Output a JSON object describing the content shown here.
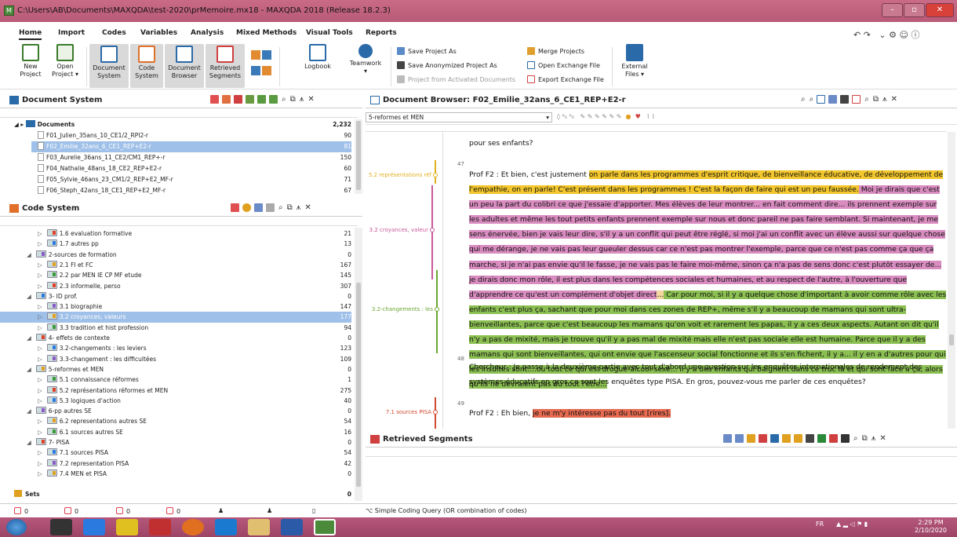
{
  "window": {
    "title": "C:\\Users\\AB\\Documents\\MAXQDA\\test-2020\\prMemoire.mx18 - MAXQDA 2018 (Release 18.2.3)",
    "app_icon": "M"
  },
  "ribbon_tabs": [
    "Home",
    "Import",
    "Codes",
    "Variables",
    "Analysis",
    "Mixed Methods",
    "Visual Tools",
    "Reports"
  ],
  "ribbon": {
    "new_project": "New\nProject",
    "open_project": "Open\nProject ▾",
    "document_system": "Document\nSystem",
    "code_system": "Code\nSystem",
    "document_browser": "Document\nBrowser",
    "retrieved_segments": "Retrieved\nSegments",
    "logbook": "Logbook",
    "teamwork": "Teamwork\n▾",
    "save_project_as": "Save Project As",
    "save_anonymized": "Save Anonymized Project As",
    "project_from_activated": "Project from Activated Documents",
    "merge_projects": "Merge Projects",
    "open_exchange": "Open Exchange File",
    "export_exchange": "Export Exchange File",
    "external_files": "External\nFiles ▾"
  },
  "document_system": {
    "title": "Document System",
    "root": {
      "label": "Documents",
      "count": "2,232"
    },
    "items": [
      {
        "label": "F01_Julien_35ans_10_CE1/2_RPI2-r",
        "count": "90"
      },
      {
        "label": "F02_Emilie_32ans_6_CE1_REP+E2-r",
        "count": "81"
      },
      {
        "label": "F03_Aurelie_36ans_11_CE2/CM1_REP+-r",
        "count": "150"
      },
      {
        "label": "F04_Nathalie_48ans_18_CE2_REP+E2-r",
        "count": "60"
      },
      {
        "label": "F05_Sylvie_46ans_23_CM1/2_REP+E2_MF-r",
        "count": "71"
      },
      {
        "label": "F06_Steph_42ans_18_CE1_REP+E2_MF-r",
        "count": "67"
      }
    ]
  },
  "code_system": {
    "title": "Code System",
    "items": [
      {
        "label": "1.6 evaluation formative",
        "count": "21",
        "level": 2
      },
      {
        "label": "1.7 autres pp",
        "count": "13",
        "level": 2
      },
      {
        "label": "2-sources de formation",
        "count": "0",
        "level": 1
      },
      {
        "label": "2.1 FI et FC",
        "count": "167",
        "level": 2
      },
      {
        "label": "2.2 par MEN IE CP MF etude",
        "count": "145",
        "level": 2
      },
      {
        "label": "2.3 informelle, perso",
        "count": "307",
        "level": 2
      },
      {
        "label": "3- ID prof.",
        "count": "0",
        "level": 1
      },
      {
        "label": "3.1 biographie",
        "count": "147",
        "level": 2
      },
      {
        "label": "3.2 croyances, valeurs",
        "count": "177",
        "level": 2
      },
      {
        "label": "3.3 tradition et hist profession",
        "count": "94",
        "level": 2
      },
      {
        "label": "4- effets de contexte",
        "count": "0",
        "level": 1
      },
      {
        "label": "3.2-changements : les leviers",
        "count": "123",
        "level": 2
      },
      {
        "label": "3.3-changement : les difficultées",
        "count": "109",
        "level": 2
      },
      {
        "label": "5-reformes et MEN",
        "count": "0",
        "level": 1
      },
      {
        "label": "5.1 connaissance réformes",
        "count": "1",
        "level": 2
      },
      {
        "label": "5.2 représentations réformes et MEN",
        "count": "275",
        "level": 2
      },
      {
        "label": "5.3 logiques d'action",
        "count": "40",
        "level": 2
      },
      {
        "label": "6-pp autres SE",
        "count": "0",
        "level": 1
      },
      {
        "label": "6.2 representations autres SE",
        "count": "54",
        "level": 2
      },
      {
        "label": "6.1 sources autres SE",
        "count": "16",
        "level": 2
      },
      {
        "label": "7- PISA",
        "count": "0",
        "level": 1
      },
      {
        "label": "7.1 sources PISA",
        "count": "54",
        "level": 2
      },
      {
        "label": "7.2 representation PISA",
        "count": "42",
        "level": 2
      },
      {
        "label": "7.4 MEN et PISA",
        "count": "0",
        "level": 2
      }
    ],
    "sets": {
      "label": "Sets",
      "count": "0"
    }
  },
  "document_browser": {
    "title": "Document Browser: F02_Emilie_32ans_6_CE1_REP+E2-r",
    "code_dropdown": "5-reformes et MEN",
    "line_top": "pour ses enfants?",
    "para47_num": "47",
    "p47_a": "Prof F2 : Et bien, c'est justement ",
    "p47_y": "on parle dans les programmes d'esprit critique, de bienveillance éducative, de développement de l'empathie, on en parle! C'est présent dans les programmes ! C'est la façon de faire qui est un peu faussée.",
    "p47_p": " Moi je dirais que c'est un peu la part du colibri ce que j'essaie d'apporter. Mes élèves de leur montrer... en fait comment dire... ils prennent exemple sur les adultes et même les tout petits enfants prennent exemple sur nous et donc pareil ne pas faire semblant. Si maintenant, je me sens énervée, bien je vais leur dire, s'il y a un conflit qui peut être réglé, si moi j'ai un conflit avec un élève aussi sur quelque chose qui me dérange, je ne vais pas leur gueuler dessus car ce n'est pas montrer l'exemple,  parce que ce n'est pas comme ça que ça marche, si je n'ai pas envie qu'il le fasse, je ne vais pas le faire moi-même, sinon ça n'a pas de sens donc c'est plutôt essayer de... je dirais donc mon rôle, il est plus dans les compétences sociales et humaines, et au respect de l'autre, à l'ouverture que d'apprendre ce qu'est un complément d'objet direct",
    "p47_b": "...",
    "p47_g": " Car pour moi, si il y a quelque chose d'important à avoir comme rôle avec les enfants c'est plus ça, sachant que pour moi dans ces zones de REP+, même s'il y a beaucoup de mamans qui sont ultra-bienveillantes, parce que c'est beaucoup les mamans qu'on voit et rarement les papas, il y a ces deux aspects. Autant on dit qu'il n'y a pas de mixité, mais je trouve qu'il y a pas mal de mixité mais elle n'est pas sociale elle est humaine. Parce que il y a des mamans qui sont bienveillantes, qui ont envie que l'ascenseur social fonctionne et ils s'en fichent, il y a... il y en a d'autres pour qui les insultes sont....ou tout ce qui est drogue-alcool-sexe... il y a des enfants qui baignent dans ce truc là et qui sont face à ça, alors qu'ils ne devraient pas du tout l'être...",
    "para48_num": "48",
    "p48": "Chercheur : Je passe à la deuxième partie avec tout d'abord une question sur les enquêtes internationales de rendement des systèmes éducatifs en gros ce sont les enquêtes type PISA. En gros, pouvez-vous me parler de ces enquêtes?",
    "para49_num": "49",
    "p49_a": "Prof F2 : Eh bien, ",
    "p49_r": "je ne m'y intéresse pas du tout [rires].",
    "code_labels": [
      {
        "text": "5.2 représentations réf",
        "color": "#e0b020"
      },
      {
        "text": "3.2 croyances, valeur",
        "color": "#c65a9a"
      },
      {
        "text": "3.2-changements : les",
        "color": "#6aa530"
      },
      {
        "text": "7.1 sources PISA",
        "color": "#d04a30"
      }
    ]
  },
  "retrieved_segments": {
    "title": "Retrieved Segments"
  },
  "status": {
    "docs": "0",
    "codes": "0",
    "code2": "0",
    "code3": "0",
    "query": "Simple Coding Query (OR combination of codes)"
  },
  "taskbar": {
    "lang": "FR",
    "time": "2:29 PM",
    "date": "2/10/2020"
  },
  "colors": {
    "accent_blue": "#9fc0e8",
    "yellow": "#f2c62c",
    "pink": "#d98cc0",
    "green": "#8bbf52",
    "red": "#e66a50"
  }
}
